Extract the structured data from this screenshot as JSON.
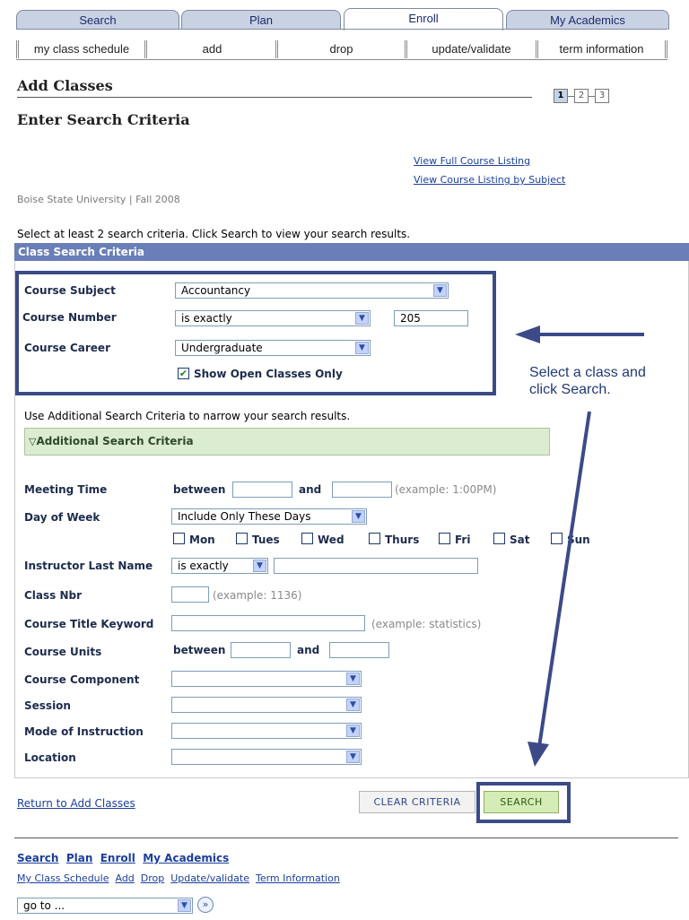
{
  "tabs": [
    {
      "label": "Search"
    },
    {
      "label": "Plan"
    },
    {
      "label": "Enroll",
      "active": true
    },
    {
      "label": "My Academics"
    }
  ],
  "subtabs": [
    "my class schedule",
    "add",
    "drop",
    "update/validate",
    "term information"
  ],
  "page": {
    "title": "Add Classes",
    "subtitle": "Enter Search Criteria",
    "steps": [
      "1",
      "2",
      "3"
    ],
    "links": {
      "full_listing": "View Full Course Listing",
      "by_subject": "View Course Listing by Subject"
    },
    "term": "Boise State University | Fall 2008",
    "instructions": "Select at least 2 search criteria. Click Search to view your search results."
  },
  "criteria": {
    "band": "Class Search Criteria",
    "subject": {
      "label": "Course Subject",
      "value": "Accountancy"
    },
    "number": {
      "label": "Course Number",
      "operator": "is exactly",
      "value": "205"
    },
    "career": {
      "label": "Course Career",
      "value": "Undergraduate"
    },
    "open_only": {
      "label": "Show Open Classes Only",
      "checked": true
    },
    "additional_note": "Use Additional Search Criteria to narrow your search results.",
    "additional_header": "Additional Search Criteria"
  },
  "additional": {
    "meeting_time": {
      "label": "Meeting Time",
      "between": "between",
      "and": "and",
      "example": "(example: 1:00PM)"
    },
    "day_of_week": {
      "label": "Day of Week",
      "value": "Include Only These Days",
      "days": [
        "Mon",
        "Tues",
        "Wed",
        "Thurs",
        "Fri",
        "Sat",
        "Sun"
      ]
    },
    "instructor": {
      "label": "Instructor Last Name",
      "operator": "is exactly"
    },
    "class_nbr": {
      "label": "Class Nbr",
      "example": "(example: 1136)"
    },
    "title_keyword": {
      "label": "Course Title Keyword",
      "example": "(example: statistics)"
    },
    "units": {
      "label": "Course Units",
      "between": "between",
      "and": "and"
    },
    "component": {
      "label": "Course Component"
    },
    "session": {
      "label": "Session"
    },
    "mode": {
      "label": "Mode of Instruction"
    },
    "location": {
      "label": "Location"
    }
  },
  "callout": {
    "line1": "Select a class and",
    "line2": "click Search."
  },
  "actions": {
    "return": "Return to Add Classes",
    "clear": "CLEAR CRITERIA",
    "search": "SEARCH"
  },
  "footer": {
    "nav1": [
      "Search",
      "Plan",
      "Enroll",
      "My Academics"
    ],
    "nav2": [
      "My Class Schedule",
      "Add",
      "Drop",
      "Update/validate",
      "Term Information"
    ],
    "goto": "go to ..."
  },
  "colors": {
    "band": "#6a7fb8",
    "highlight": "#3c4a88",
    "search_button": "#d6ecb6",
    "additional_bar": "#dcecd0"
  }
}
